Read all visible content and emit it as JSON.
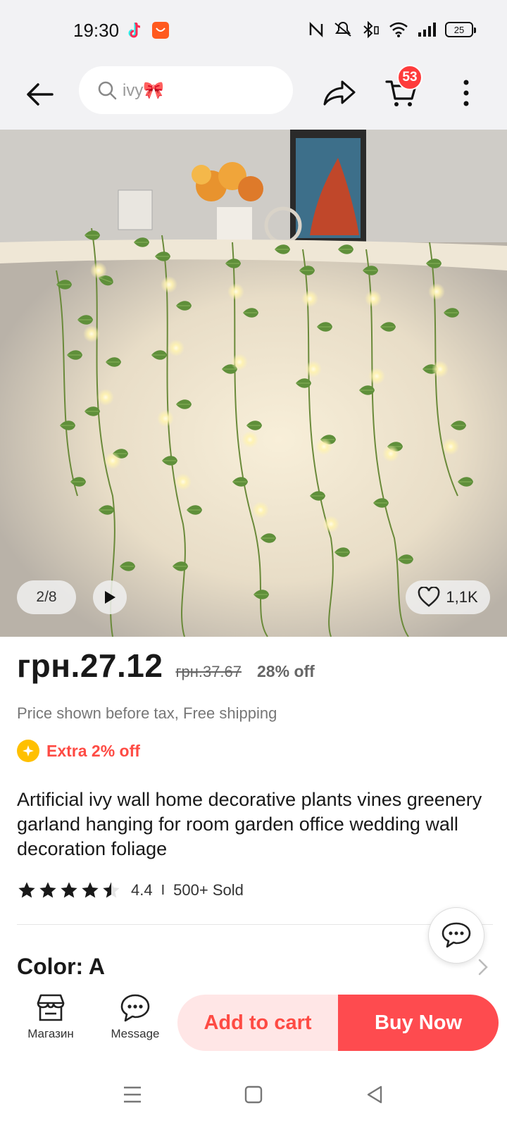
{
  "status_bar": {
    "time": "19:30",
    "battery": "25",
    "icons": [
      "tiktok-icon",
      "aliexpress-icon",
      "nfc-icon",
      "mute-icon",
      "bluetooth-icon",
      "wifi-icon",
      "signal-icon",
      "battery-icon"
    ]
  },
  "header": {
    "search_text": "ivy🎀",
    "cart_count": "53"
  },
  "gallery": {
    "counter": "2/8",
    "likes": "1,1K"
  },
  "price": {
    "current": "грн.27.12",
    "original": "грн.37.67",
    "discount": "28% off",
    "tax_note": "Price shown before tax, Free shipping",
    "extra": "Extra 2% off"
  },
  "product": {
    "title": "Artificial ivy wall home decorative plants vines greenery garland hanging for room garden office wedding wall decoration foliage",
    "rating": "4.4",
    "rating_separator": "I",
    "rating_stars": 4.4,
    "sold": "500+ Sold",
    "color_label": "Color: A"
  },
  "bottom_bar": {
    "store_label": "Магазин",
    "message_label": "Message",
    "add_to_cart": "Add to cart",
    "buy_now": "Buy Now"
  },
  "colors": {
    "accent_red": "#fe4b4f",
    "badge_red": "#fe3b3b",
    "add_cart_bg": "#ffe6e6",
    "coin_yellow": "#ffc000"
  }
}
